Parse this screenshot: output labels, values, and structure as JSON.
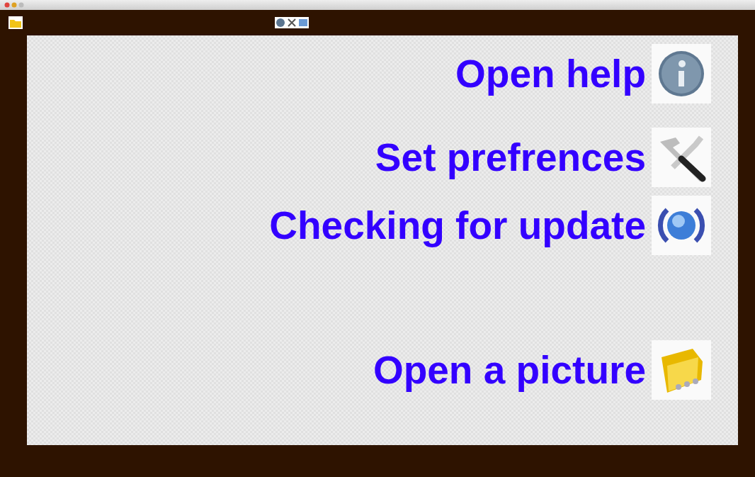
{
  "actions": [
    {
      "label": "Open help",
      "kind": "help"
    },
    {
      "label": "Set prefrences",
      "kind": "preferences"
    },
    {
      "label": "Checking for update",
      "kind": "update"
    },
    {
      "label": "Open a picture",
      "kind": "open"
    }
  ]
}
